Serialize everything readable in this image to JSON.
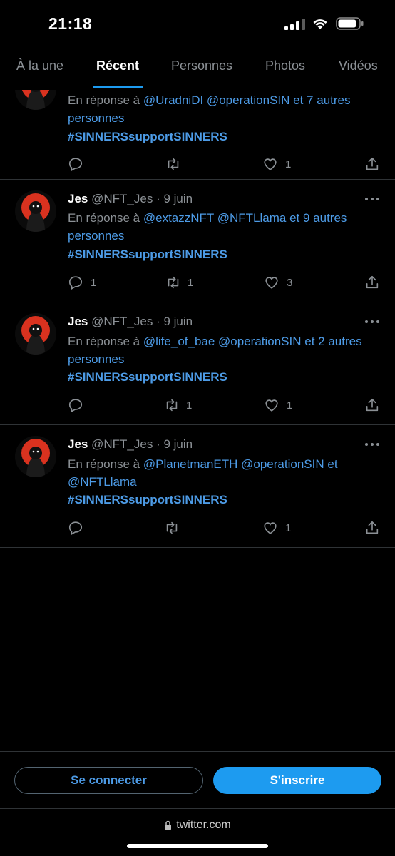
{
  "status_bar": {
    "time": "21:18"
  },
  "tabs": [
    {
      "label": "À la une"
    },
    {
      "label": "Récent"
    },
    {
      "label": "Personnes"
    },
    {
      "label": "Photos"
    },
    {
      "label": "Vidéos"
    }
  ],
  "active_tab": "Récent",
  "tweets": [
    {
      "reply_prefix": "En réponse à",
      "mentions": "@UradniDI @operationSIN",
      "reply_suffix": "et 7 autres personnes",
      "hashtag": "#SINNERSsupportSINNERS",
      "reply_count": "",
      "retweet_count": "",
      "like_count": "1"
    },
    {
      "name": "Jes",
      "handle": "@NFT_Jes",
      "date": "· 9 juin",
      "reply_prefix": "En réponse à",
      "mentions": "@extazzNFT @NFTLlama",
      "reply_suffix": "et 9 autres personnes",
      "hashtag": "#SINNERSsupportSINNERS",
      "reply_count": "1",
      "retweet_count": "1",
      "like_count": "3"
    },
    {
      "name": "Jes",
      "handle": "@NFT_Jes",
      "date": "· 9 juin",
      "reply_prefix": "En réponse à",
      "mentions": "@life_of_bae @operationSIN",
      "reply_suffix": "et 2 autres personnes",
      "hashtag": "#SINNERSsupportSINNERS",
      "reply_count": "",
      "retweet_count": "1",
      "like_count": "1"
    },
    {
      "name": "Jes",
      "handle": "@NFT_Jes",
      "date": "· 9 juin",
      "reply_prefix": "En réponse à",
      "mentions": "@PlanetmanETH @operationSIN",
      "reply_suffix": "et",
      "mention_extra": "@NFTLlama",
      "hashtag": "#SINNERSsupportSINNERS",
      "reply_count": "",
      "retweet_count": "",
      "like_count": "1"
    }
  ],
  "bottom": {
    "login_label": "Se connecter",
    "signup_label": "S'inscrire",
    "url": "twitter.com"
  },
  "colors": {
    "background": "#000000",
    "accent": "#1d9bf0",
    "link": "#4d9be6",
    "muted": "#8b9095",
    "separator": "#2f3336"
  },
  "icons": [
    "reply-icon",
    "retweet-icon",
    "like-icon",
    "share-icon",
    "more-icon",
    "lock-icon",
    "wifi-icon",
    "signal-icon",
    "battery-icon"
  ]
}
